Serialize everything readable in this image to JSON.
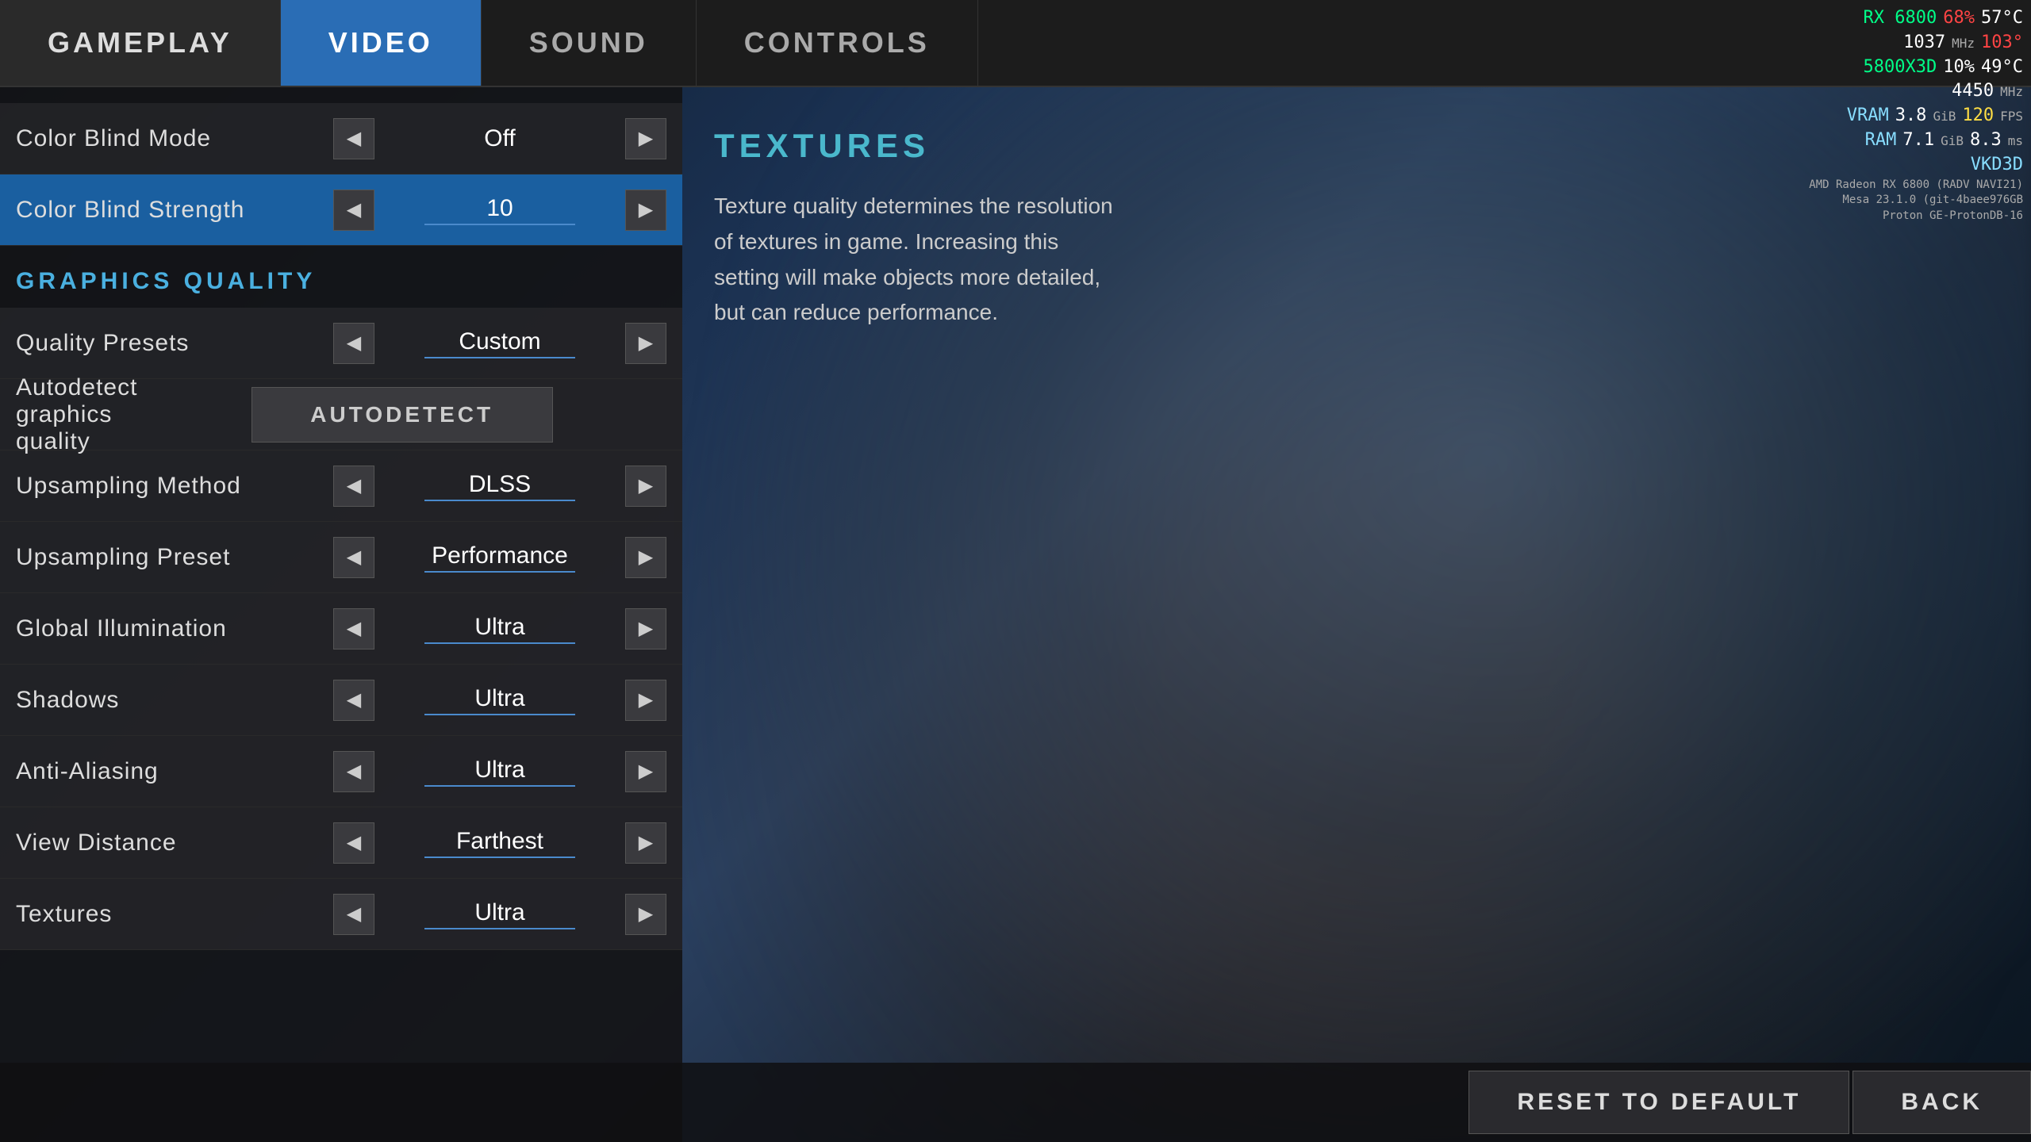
{
  "nav": {
    "tabs": [
      {
        "id": "gameplay",
        "label": "GAMEPLAY",
        "active": false
      },
      {
        "id": "video",
        "label": "VIDEO",
        "active": true
      },
      {
        "id": "sound",
        "label": "SOUND",
        "active": false
      },
      {
        "id": "controls",
        "label": "CONTROLS",
        "active": false
      }
    ]
  },
  "settings": {
    "section_color_blind": {
      "rows": [
        {
          "id": "color-blind-mode",
          "label": "Color Blind Mode",
          "value": "Off",
          "active": false
        },
        {
          "id": "color-blind-strength",
          "label": "Color Blind Strength",
          "value": "10",
          "active": true
        }
      ]
    },
    "section_graphics": {
      "header": "GRAPHICS QUALITY",
      "rows": [
        {
          "id": "quality-presets",
          "label": "Quality Presets",
          "value": "Custom",
          "active": false
        },
        {
          "id": "autodetect",
          "label": "Autodetect graphics quality",
          "value": "AUTODETECT",
          "type": "button"
        },
        {
          "id": "upsampling-method",
          "label": "Upsampling Method",
          "value": "DLSS",
          "active": false
        },
        {
          "id": "upsampling-preset",
          "label": "Upsampling Preset",
          "value": "Performance",
          "active": false
        },
        {
          "id": "global-illumination",
          "label": "Global Illumination",
          "value": "Ultra",
          "active": false
        },
        {
          "id": "shadows",
          "label": "Shadows",
          "value": "Ultra",
          "active": false
        },
        {
          "id": "anti-aliasing",
          "label": "Anti-Aliasing",
          "value": "Ultra",
          "active": false
        },
        {
          "id": "view-distance",
          "label": "View Distance",
          "value": "Farthest",
          "active": false
        },
        {
          "id": "textures",
          "label": "Textures",
          "value": "Ultra",
          "active": false
        }
      ]
    }
  },
  "info_panel": {
    "title": "TEXTURES",
    "text": "Texture quality determines the resolution of textures in game. Increasing this setting will make objects more detailed, but can reduce performance."
  },
  "buttons": {
    "reset": "RESET TO DEFAULT",
    "back": "BACK"
  },
  "hud": {
    "gpu_name": "RX 6800",
    "gpu_usage": "68%",
    "gpu_clock": "1037",
    "gpu_clock_unit": "MHz",
    "cpu_usage": "103°",
    "cpu_clock": "5800X3D",
    "cpu_pct": "10%",
    "cpu_temp": "49°C",
    "mem_clock": "4450",
    "mem_clock_unit": "MHz",
    "vram_label": "VRAM",
    "vram_val": "3.8",
    "vram_unit": "GiB",
    "ram_label": "RAM",
    "ram_val": "7.1",
    "ram_unit": "GiB",
    "vkd3d_label": "VKD3D",
    "fps_val": "120",
    "fps_unit": "FPS",
    "ms_val": "8.3",
    "ms_unit": "ms",
    "sys_info": "AMD Radeon RX 6800 (RADV NAVI21)",
    "mesa_info": "Mesa 23.1.0 (git-4baee976GB",
    "proton_info": "Proton GE-ProtonDB-16",
    "gpu_temp": "57°C"
  }
}
